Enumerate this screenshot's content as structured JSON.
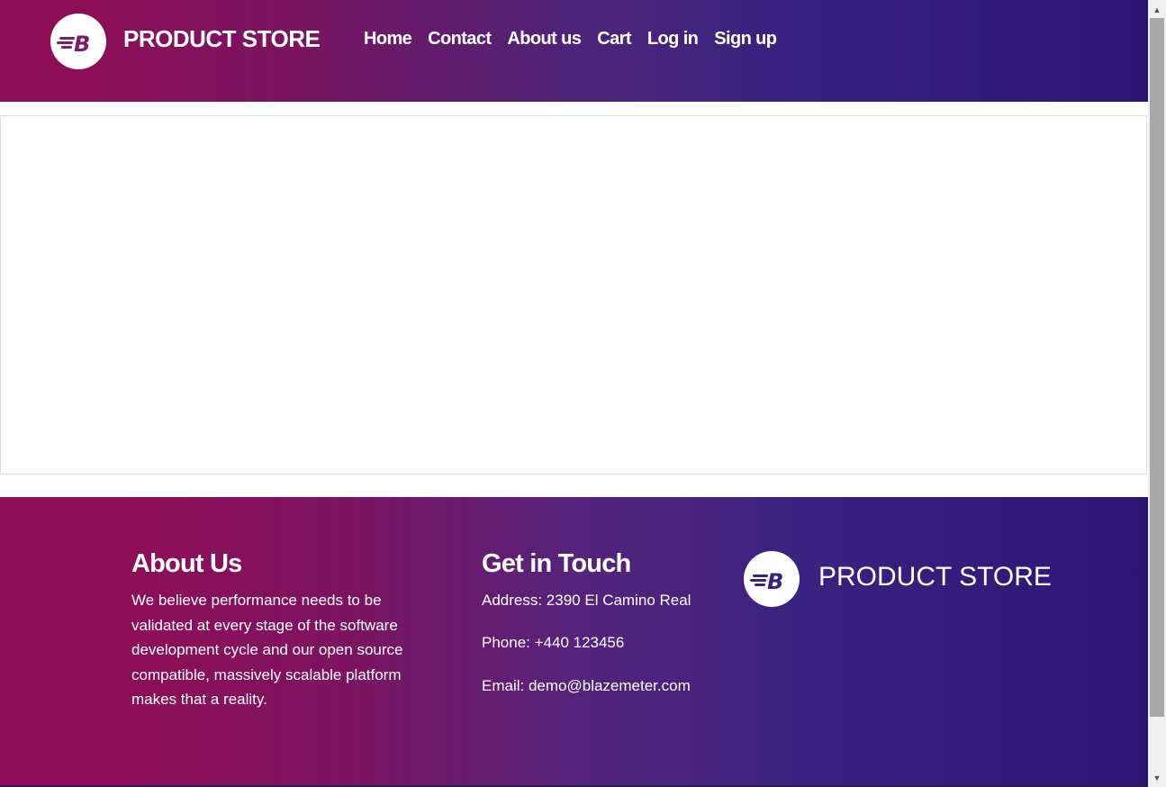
{
  "header": {
    "brand": "PRODUCT STORE",
    "logo_letter": "B",
    "nav": [
      {
        "label": "Home"
      },
      {
        "label": "Contact"
      },
      {
        "label": "About us"
      },
      {
        "label": "Cart"
      },
      {
        "label": "Log in"
      },
      {
        "label": "Sign up"
      }
    ]
  },
  "footer": {
    "about": {
      "heading": "About Us",
      "lines": [
        "We believe performance needs to be",
        "validated at every stage of the software",
        "development cycle and our open source",
        "compatible, massively scalable platform",
        "makes that a reality."
      ]
    },
    "contact": {
      "heading": "Get in Touch",
      "address": "Address: 2390 El Camino Real",
      "phone": "Phone: +440 123456",
      "email": "Email: demo@blazemeter.com"
    },
    "brand": "PRODUCT STORE"
  },
  "colors": {
    "gradient_start": "#8d0e57",
    "gradient_end": "#2b1573",
    "logo_letter": "#3a2281"
  },
  "icons": {
    "logo": "blazemeter-b-logo-icon",
    "scroll_up": "scroll-up-arrow-icon",
    "scroll_down": "scroll-down-arrow-icon"
  }
}
